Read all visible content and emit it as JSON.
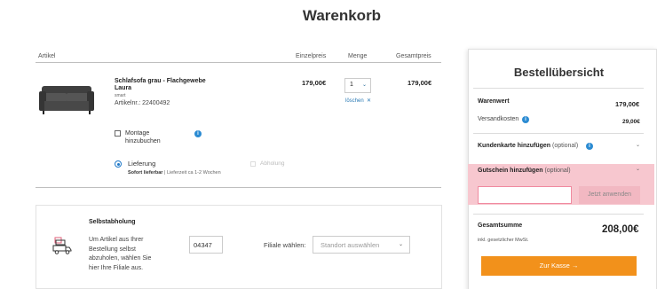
{
  "page": {
    "title": "Warenkorb"
  },
  "table_headers": {
    "artikel": "Artikel",
    "einzelpreis": "Einzelpreis",
    "menge": "Menge",
    "gesamtpreis": "Gesamtpreis"
  },
  "item": {
    "name": "Schlafsofa grau - Flachgewebe Laura",
    "brand": "smart",
    "artnr": "Artikelnr.: 22400492",
    "unit_price": "179,00€",
    "quantity": "1",
    "total_price": "179,00€",
    "remove_label": "löschen",
    "remove_icon": "close-icon",
    "image_icon": "sofa-image"
  },
  "options": {
    "montage_label": "Montage hinzubuchen",
    "montage_checked": false,
    "lieferung_label": "Lieferung",
    "lieferung_status": "Sofort lieferbar",
    "lieferung_time": "Lieferzeit ca 1-2 Wochen",
    "abholung_label": "Abholung"
  },
  "selbstabholung": {
    "title": "Selbstabholung",
    "text": "Um Artikel aus Ihrer Bestellung selbst abzuholen, wählen Sie hier Ihre Filiale aus.",
    "plz_value": "04347",
    "filiale_label": "Filiale wählen:",
    "filiale_placeholder": "Standort auswählen"
  },
  "summary": {
    "title": "Bestellübersicht",
    "warenwert_label": "Warenwert",
    "warenwert_value": "179,00€",
    "versand_label": "Versandkosten",
    "versand_value": "29,00€",
    "kundenkarte_label": "Kundenkarte hinzufügen",
    "kundenkarte_optional": "(optional)",
    "gutschein_label": "Gutschein hinzufügen",
    "gutschein_optional": "(optional)",
    "gutschein_button": "Jetzt anwenden",
    "gesamt_label": "Gesamtsumme",
    "gesamt_value": "208,00€",
    "mwst_label": "inkl. gesetzlicher MwSt.",
    "kasse_label": "Zur Kasse →"
  },
  "colors": {
    "accent_orange": "#f2911b",
    "highlight_pink": "#f7c7cf",
    "link_blue": "#2a7ab5",
    "info_blue": "#2b8bd2"
  }
}
